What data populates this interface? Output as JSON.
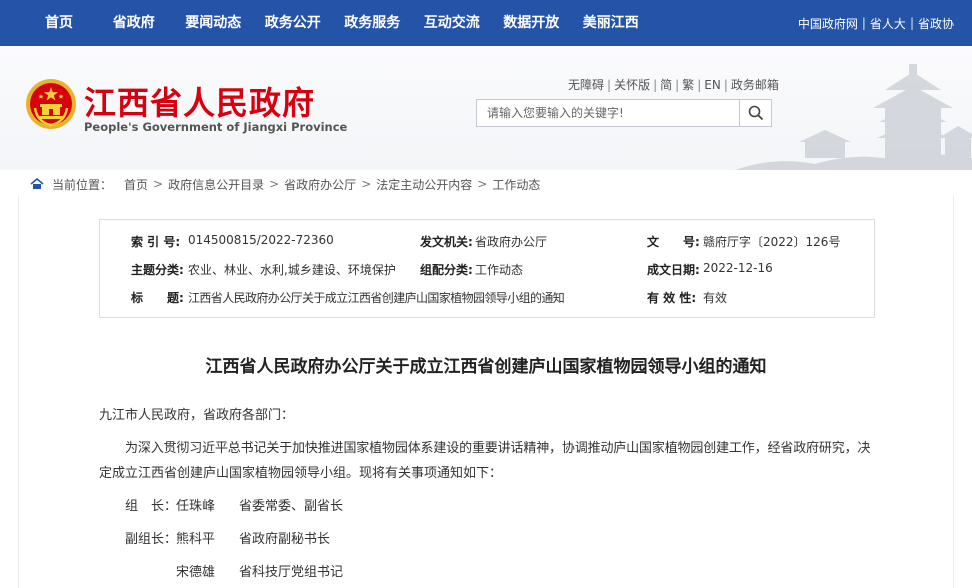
{
  "topnav": {
    "items": [
      "首页",
      "省政府",
      "要闻动态",
      "政务公开",
      "政务服务",
      "互动交流",
      "数据开放",
      "美丽江西"
    ],
    "right_links": [
      "中国政府网",
      "省人大",
      "省政协"
    ]
  },
  "header": {
    "title": "江西省人民政府",
    "subtitle": "People's Government of Jiangxi Province",
    "tools": [
      "无障碍",
      "关怀版",
      "简",
      "繁",
      "EN",
      "政务邮箱"
    ],
    "search_placeholder": "请输入您要输入的关键字!"
  },
  "breadcrumb": {
    "lead": "当前位置：",
    "items": [
      "首页",
      "政府信息公开目录",
      "省政府办公厅",
      "法定主动公开内容",
      "工作动态"
    ]
  },
  "meta": {
    "index_label": "索 引 号:",
    "index_value": "014500815/2022-72360",
    "issuer_label": "发文机关:",
    "issuer_value": "省政府办公厅",
    "docno_label": "文　　号:",
    "docno_value": "赣府厅字〔2022〕126号",
    "topic_label": "主题分类:",
    "topic_value": "农业、林业、水利,城乡建设、环境保护",
    "group_label": "组配分类:",
    "group_value": "工作动态",
    "date_label": "成文日期:",
    "date_value": "2022-12-16",
    "subject_label": "标　　题:",
    "subject_value": "江西省人民政府办公厅关于成立江西省创建庐山国家植物园领导小组的通知",
    "validity_label": "有 效 性:",
    "validity_value": "有效"
  },
  "article": {
    "title": "江西省人民政府办公厅关于成立江西省创建庐山国家植物园领导小组的通知",
    "salutation": "九江市人民政府，省政府各部门：",
    "para1_line1": "为深入贯彻习近平总书记关于加快推进国家植物园体系建设的重要讲话精神，协调推动庐山国家植物园创建工作，经省政府研究，决",
    "para1_line2": "定成立江西省创建庐山国家植物园领导小组。现将有关事项通知如下：",
    "members": [
      {
        "role": "组　长：",
        "name": "任珠峰",
        "position": "省委常委、副省长"
      },
      {
        "role": "副组长：",
        "name": "熊科平",
        "position": "省政府副秘书长"
      },
      {
        "role": "",
        "name": "宋德雄",
        "position": "省科技厅党组书记"
      }
    ]
  },
  "colors": {
    "nav_bg": "#2453a8",
    "title_red": "#d7000f"
  }
}
